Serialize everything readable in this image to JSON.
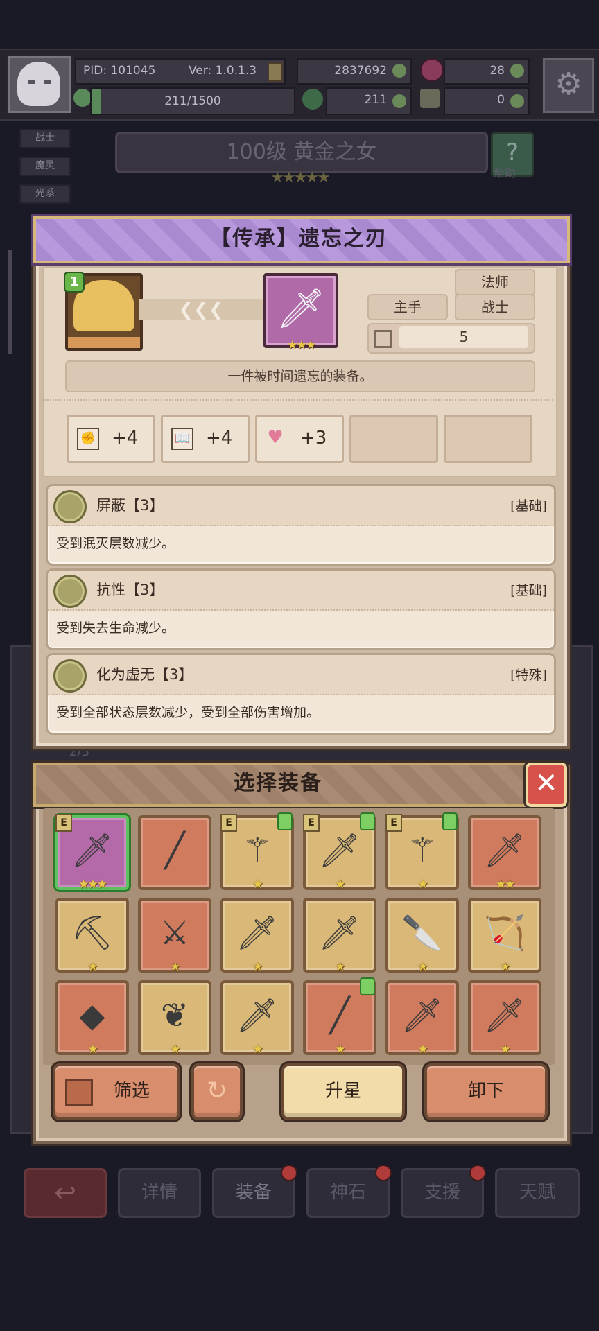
{
  "status": {
    "pid": "PID: 101045",
    "version": "Ver: 1.0.1.3",
    "gold": "2837692",
    "gems": "28",
    "energy": "211/1500",
    "clover": "211",
    "keys": "0"
  },
  "background": {
    "tags": [
      "战士",
      "魔灵",
      "光系"
    ],
    "level_title": "100级  黄金之女",
    "level_stars": "★★★★★",
    "help_label": "帮助",
    "page_counter": "2/3"
  },
  "detail": {
    "title": "【传承】遗忘之刃",
    "hero_level": "1",
    "item_stars": "★★★",
    "tag_mage": "法师",
    "tag_mainhand": "主手",
    "tag_warrior": "战士",
    "slot_value": "5",
    "description": "一件被时间遗忘的装备。",
    "stats": [
      {
        "icon": "fist-icon",
        "value": "+4"
      },
      {
        "icon": "book-icon",
        "value": "+4"
      },
      {
        "icon": "heart-icon",
        "value": "+3"
      }
    ],
    "skills": [
      {
        "name": "屏蔽【3】",
        "type": "[基础]",
        "desc": "受到泯灭层数减少。"
      },
      {
        "name": "抗性【3】",
        "type": "[基础]",
        "desc": "受到失去生命减少。"
      },
      {
        "name": "化为虚无【3】",
        "type": "[特殊]",
        "desc": "受到全部状态层数减少，受到全部伤害增加。"
      }
    ]
  },
  "select": {
    "title": "选择装备",
    "close_label": "✕",
    "equipped_mark": "E",
    "items": [
      {
        "glyph": "🗡",
        "bg": "sel",
        "stars": "★★★",
        "equipped": true,
        "upgrade": false
      },
      {
        "glyph": "╱",
        "bg": "red",
        "stars": "",
        "equipped": false,
        "upgrade": false
      },
      {
        "glyph": "⚚",
        "bg": "gold",
        "stars": "★",
        "equipped": true,
        "upgrade": true
      },
      {
        "glyph": "🗡",
        "bg": "gold",
        "stars": "★",
        "equipped": true,
        "upgrade": true
      },
      {
        "glyph": "⚚",
        "bg": "gold",
        "stars": "★",
        "equipped": true,
        "upgrade": true
      },
      {
        "glyph": "🗡",
        "bg": "red",
        "stars": "★★",
        "equipped": false,
        "upgrade": false
      },
      {
        "glyph": "⛏",
        "bg": "gold",
        "stars": "★",
        "equipped": false,
        "upgrade": false
      },
      {
        "glyph": "⚔",
        "bg": "red",
        "stars": "★",
        "equipped": false,
        "upgrade": false
      },
      {
        "glyph": "🗡",
        "bg": "gold",
        "stars": "★",
        "equipped": false,
        "upgrade": false
      },
      {
        "glyph": "🗡",
        "bg": "gold",
        "stars": "★",
        "equipped": false,
        "upgrade": false
      },
      {
        "glyph": "🔪",
        "bg": "gold",
        "stars": "★",
        "equipped": false,
        "upgrade": false
      },
      {
        "glyph": "🏹",
        "bg": "gold",
        "stars": "★",
        "equipped": false,
        "upgrade": false
      },
      {
        "glyph": "◆",
        "bg": "red",
        "stars": "★",
        "equipped": false,
        "upgrade": false
      },
      {
        "glyph": "❦",
        "bg": "gold",
        "stars": "★",
        "equipped": false,
        "upgrade": false
      },
      {
        "glyph": "🗡",
        "bg": "gold",
        "stars": "★",
        "equipped": false,
        "upgrade": false
      },
      {
        "glyph": "╱",
        "bg": "red",
        "stars": "★",
        "equipped": false,
        "upgrade": true
      },
      {
        "glyph": "🗡",
        "bg": "red",
        "stars": "★",
        "equipped": false,
        "upgrade": false
      },
      {
        "glyph": "🗡",
        "bg": "red",
        "stars": "★",
        "equipped": false,
        "upgrade": false
      }
    ],
    "filter_label": "筛选",
    "refresh_label": "↻",
    "upgrade_label": "升星",
    "unequip_label": "卸下"
  },
  "nav": {
    "back_label": "↩",
    "items": [
      "详情",
      "装备",
      "神石",
      "支援",
      "天赋"
    ]
  },
  "colors": {
    "purple_banner": "#a989d0",
    "select_green": "#5ec05e",
    "close_red": "#d8524c"
  }
}
